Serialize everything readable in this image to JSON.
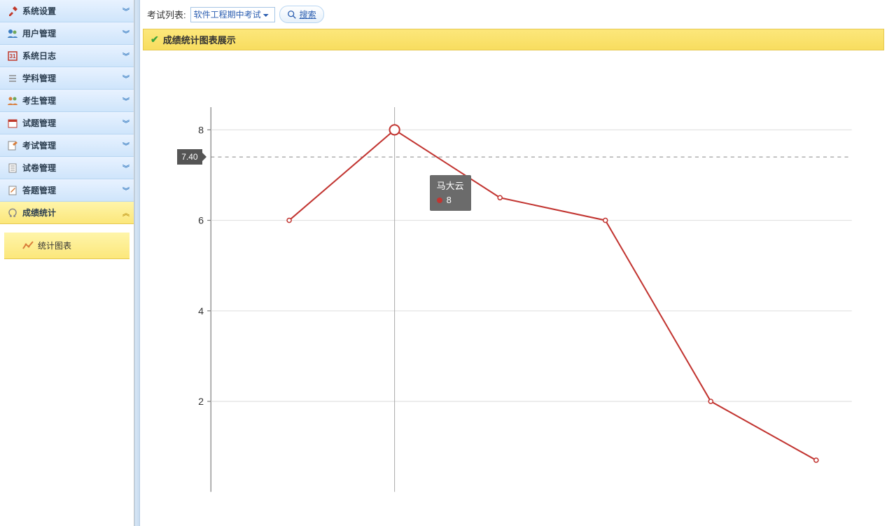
{
  "sidebar": {
    "items": [
      {
        "label": "系统设置",
        "icon": "tools"
      },
      {
        "label": "用户管理",
        "icon": "users"
      },
      {
        "label": "系统日志",
        "icon": "log"
      },
      {
        "label": "学科管理",
        "icon": "list"
      },
      {
        "label": "考生管理",
        "icon": "students"
      },
      {
        "label": "试题管理",
        "icon": "calendar"
      },
      {
        "label": "考试管理",
        "icon": "edit"
      },
      {
        "label": "试卷管理",
        "icon": "doc"
      },
      {
        "label": "答题管理",
        "icon": "pen"
      },
      {
        "label": "成绩统计",
        "icon": "omega",
        "active": true
      }
    ],
    "subitem_label": "统计图表"
  },
  "toolbar": {
    "list_label": "考试列表:",
    "select_value": "软件工程期中考试",
    "search_label": "搜索"
  },
  "panel": {
    "title": "成绩统计图表展示"
  },
  "tooltip": {
    "name": "马大云",
    "value": "8"
  },
  "yaxis_badge": "7.40",
  "chart_data": {
    "type": "line",
    "x": [
      0,
      1,
      2,
      3,
      4,
      5
    ],
    "values": [
      6,
      8,
      6.5,
      6,
      2,
      0.7
    ],
    "highlighted_index": 1,
    "highlighted_label": "马大云",
    "ylim": [
      0,
      8.5
    ],
    "yticks": [
      2,
      4,
      6,
      8
    ],
    "crosshair_y": 7.4,
    "color": "#c23531",
    "title": "",
    "xlabel": "",
    "ylabel": ""
  }
}
